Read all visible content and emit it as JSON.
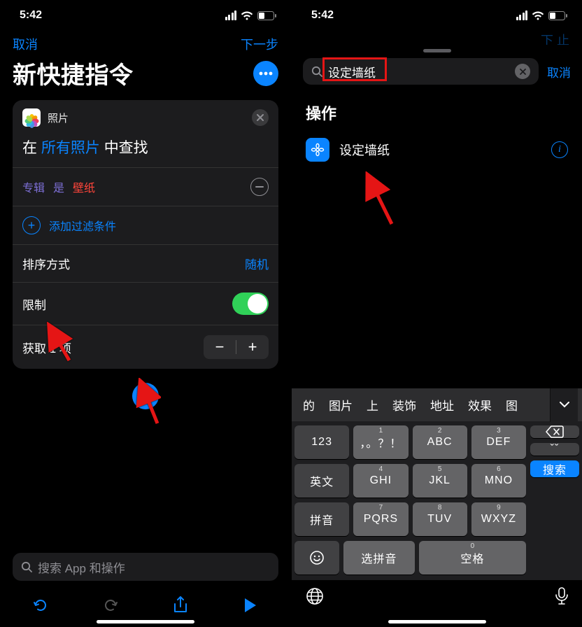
{
  "status": {
    "time": "5:42"
  },
  "left": {
    "nav": {
      "cancel": "取消",
      "next": "下一步"
    },
    "title": "新快捷指令",
    "card": {
      "head": "照片",
      "line_pre": "在",
      "line_token": "所有照片",
      "line_post": "中查找",
      "filter_key": "专辑",
      "filter_op": "是",
      "filter_val": "壁纸",
      "add_filter": "添加过滤条件",
      "sort_label": "排序方式",
      "sort_value": "随机",
      "limit_label": "限制",
      "limit_on": true,
      "get_label": "获取 1 项"
    },
    "search_placeholder": "搜索 App 和操作"
  },
  "right": {
    "search_value": "设定墙纸",
    "cancel": "取消",
    "nav_next_peek": "下 止",
    "section": "操作",
    "result_label": "设定墙纸",
    "candidates": [
      "的",
      "图片",
      "上",
      "装饰",
      "地址",
      "效果",
      "图"
    ],
    "keys": {
      "r1": [
        "123",
        "，。？！",
        "ABC",
        "DEF"
      ],
      "r2": [
        "英文",
        "GHI",
        "JKL",
        "MNO"
      ],
      "r3": [
        "拼音",
        "PQRS",
        "TUV",
        "WXYZ"
      ],
      "r4_select": "选拼音",
      "r4_space": "空格",
      "search": "搜索",
      "delete": "⌫",
      "tone": "ˇˇ"
    }
  }
}
